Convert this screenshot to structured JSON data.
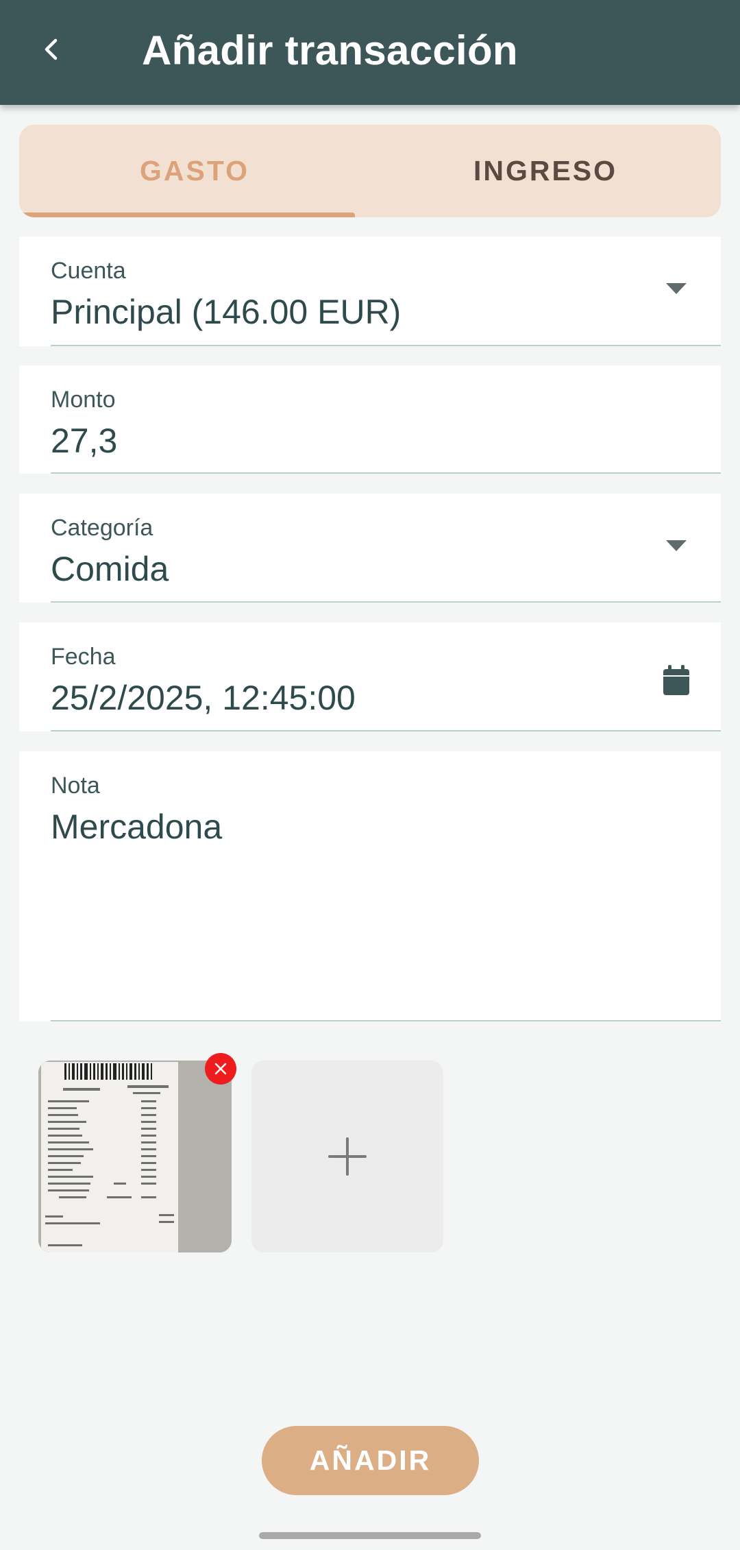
{
  "appbar": {
    "title": "Añadir transacción",
    "back_icon": "chevron-left-icon"
  },
  "tabs": [
    {
      "label": "GASTO",
      "selected": true
    },
    {
      "label": "INGRESO",
      "selected": false
    }
  ],
  "form": {
    "account": {
      "label": "Cuenta",
      "value": "Principal (146.00 EUR)"
    },
    "amount": {
      "label": "Monto",
      "value": "27,3"
    },
    "category": {
      "label": "Categoría",
      "value": "Comida"
    },
    "date": {
      "label": "Fecha",
      "value": "25/2/2025, 12:45:00",
      "icon": "calendar-icon"
    },
    "note": {
      "label": "Nota",
      "value": "Mercadona"
    }
  },
  "attachments": {
    "photo_count": 1,
    "remove_icon": "close-icon",
    "add_icon": "plus-icon"
  },
  "actions": {
    "submit_label": "AÑADIR"
  },
  "colors": {
    "appbar": "#3d5759",
    "accent": "#dca37a",
    "tab_background": "#f2e0d2",
    "button": "#dcae86",
    "remove": "#ee1c1c"
  }
}
